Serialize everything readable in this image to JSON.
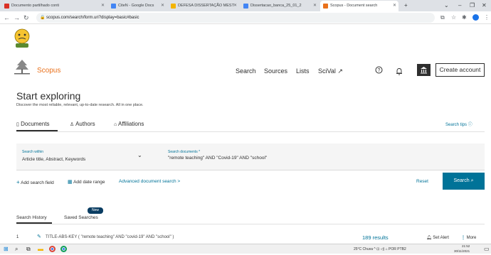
{
  "browser": {
    "tabs": [
      {
        "label": "Documento partilhado conti",
        "color": "#d93025"
      },
      {
        "label": "CiteN - Google Docs",
        "color": "#4285f4"
      },
      {
        "label": "DEFESA DISSERTAÇÃO MEST",
        "color": "#f4b400"
      },
      {
        "label": "Dissertacao_banca_25_01_2",
        "color": "#4285f4"
      },
      {
        "label": "Scopus - Document search",
        "color": "#e9711c"
      }
    ],
    "url": "scopus.com/search/form.uri?display=basic#basic"
  },
  "header": {
    "brand": "Scopus",
    "nav": [
      "Search",
      "Sources",
      "Lists",
      "SciVal ↗"
    ],
    "create_account": "Create account"
  },
  "main": {
    "title": "Start exploring",
    "subtitle": "Discover the most reliable, relevant, up-to-date research. All in one place.",
    "tabs": [
      "Documents",
      "Authors",
      "Affiliations"
    ],
    "search_tips": "Search tips",
    "search_within_label": "Search within",
    "search_within_value": "Article title, Abstract, Keywords",
    "search_documents_label": "Search documents *",
    "search_documents_value": "\"remote teaching\" AND \"Covid-19\" AND \"school\"",
    "add_search_field": "Add search field",
    "add_date_range": "Add date range",
    "advanced_search": "Advanced document search >",
    "reset": "Reset",
    "search_button": "Search"
  },
  "history": {
    "tabs": [
      "Search History",
      "Saved Searches"
    ],
    "new_badge": "New",
    "row": {
      "index": "1",
      "query": "TITLE-ABS-KEY ( \"remote teaching\" AND \"covid-19\" AND \"school\" )",
      "results": "189 results",
      "set_alert": "Set Alert",
      "more": "More"
    }
  },
  "taskbar": {
    "tray": "25°C  Chuva  ^  ⊡  ◁)  ⌂  POR PTB2",
    "time": "21:52",
    "date": "30/11/2021"
  }
}
